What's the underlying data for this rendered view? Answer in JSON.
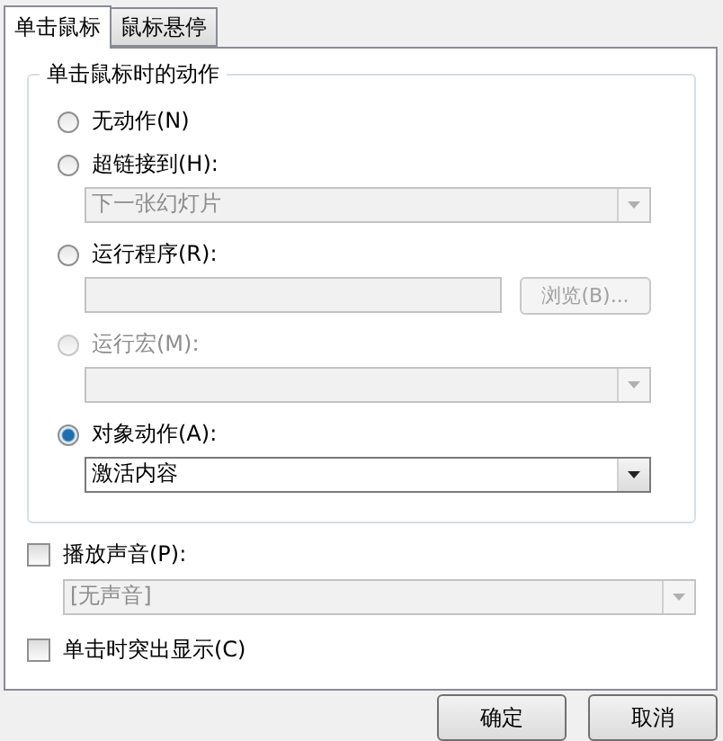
{
  "tabs": [
    {
      "label": "单击鼠标",
      "selected": true
    },
    {
      "label": "鼠标悬停",
      "selected": false
    }
  ],
  "group": {
    "title": "单击鼠标时的动作",
    "options": [
      {
        "label": "无动作(N)",
        "selected": false,
        "disabled": false
      },
      {
        "label": "超链接到(H):",
        "selected": false,
        "disabled": false,
        "control": {
          "kind": "dropdown",
          "value": "下一张幻灯片",
          "disabled": true
        }
      },
      {
        "label": "运行程序(R):",
        "selected": false,
        "disabled": false,
        "control": {
          "kind": "file",
          "button": "浏览(B)...",
          "disabled": true
        }
      },
      {
        "label": "运行宏(M):",
        "selected": false,
        "disabled": true,
        "control": {
          "kind": "dropdown",
          "disabled": true
        }
      },
      {
        "label": "对象动作(A):",
        "selected": true,
        "disabled": false,
        "control": {
          "kind": "dropdown",
          "value": "激活内容",
          "disabled": false
        }
      }
    ]
  },
  "play_sound": {
    "label": "播放声音(P):",
    "checked": false,
    "dropdown": {
      "value": "[无声音]",
      "disabled": true
    }
  },
  "highlight": {
    "label": "单击时突出显示(C)",
    "checked": false
  },
  "buttons": [
    "确定",
    "取消"
  ]
}
